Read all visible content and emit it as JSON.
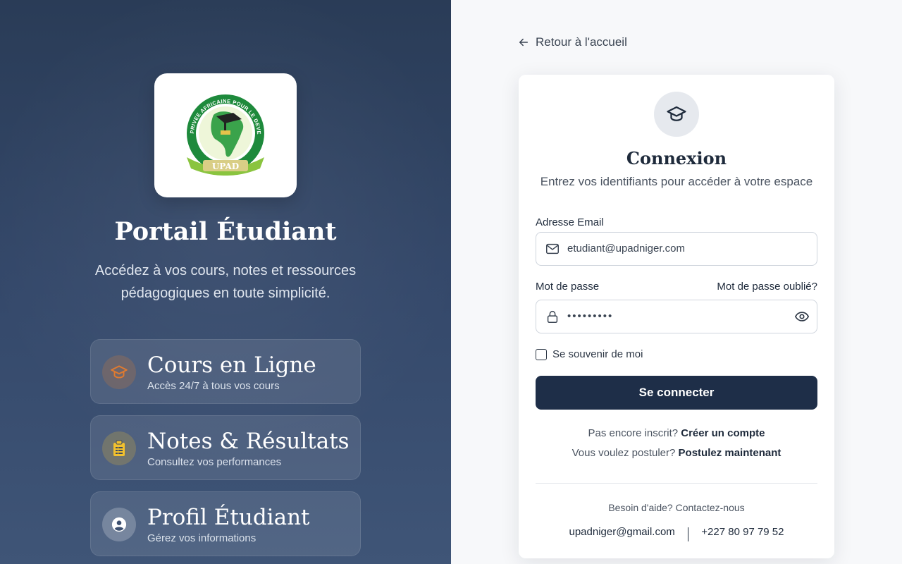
{
  "left": {
    "logo_text": "UPAD",
    "logo_ring_text": "UNIVERSITE PRIVEE AFRICAINE POUR LE DEVELOPPEMENT",
    "title": "Portail Étudiant",
    "subtitle": "Accédez à vos cours, notes et ressources pédagogiques en toute simplicité.",
    "features": [
      {
        "title": "Cours en Ligne",
        "description": "Accès 24/7 à tous vos cours",
        "icon": "graduation-cap-icon",
        "icon_color": "#e07a2f"
      },
      {
        "title": "Notes & Résultats",
        "description": "Consultez vos performances",
        "icon": "clipboard-icon",
        "icon_color": "#f2c12e"
      },
      {
        "title": "Profil Étudiant",
        "description": "Gérez vos informations",
        "icon": "user-circle-icon",
        "icon_color": "#ffffff"
      }
    ]
  },
  "right": {
    "back_label": "Retour à l'accueil",
    "card": {
      "title": "Connexion",
      "subtitle": "Entrez vos identifiants pour accéder à votre espace",
      "email_label": "Adresse Email",
      "email_value": "etudiant@upadniger.com",
      "password_label": "Mot de passe",
      "forgot_label": "Mot de passe oublié?",
      "password_value": "password1",
      "remember_label": "Se souvenir de moi",
      "submit_label": "Se connecter",
      "signup_prompt": "Pas encore inscrit?",
      "signup_link": "Créer un compte",
      "apply_prompt": "Vous voulez postuler?",
      "apply_link": "Postulez maintenant",
      "help_text": "Besoin d'aide? Contactez-nous",
      "contact_email": "upadniger@gmail.com",
      "contact_phone": "+227 80 97 79 52"
    }
  },
  "colors": {
    "left_panel": "#2f4260",
    "primary_button": "#1e2e48",
    "text_dark": "#1e2a3b"
  }
}
